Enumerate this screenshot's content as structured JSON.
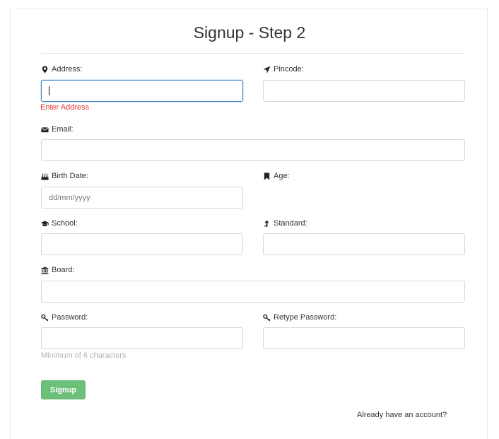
{
  "form": {
    "title": "Signup - Step 2",
    "address": {
      "label": "Address:",
      "value": "",
      "error": "Enter Address",
      "icon": "map-marker-icon"
    },
    "pincode": {
      "label": "Pincode:",
      "value": "",
      "icon": "location-arrow-icon"
    },
    "email": {
      "label": "Email:",
      "value": "",
      "icon": "envelope-icon"
    },
    "birth_date": {
      "label": "Birth Date:",
      "placeholder": "dd/mm/yyyy",
      "icon": "birthday-cake-icon"
    },
    "age": {
      "label": "Age:",
      "icon": "bookmark-icon"
    },
    "school": {
      "label": "School:",
      "value": "",
      "icon": "graduation-cap-icon"
    },
    "standard": {
      "label": "Standard:",
      "value": "",
      "icon": "level-up-icon"
    },
    "board": {
      "label": "Board:",
      "value": "",
      "icon": "institution-icon"
    },
    "password": {
      "label": "Password:",
      "value": "",
      "hint": "Minimum of 6 characters",
      "icon": "key-icon"
    },
    "retype_password": {
      "label": "Retype Password:",
      "value": "",
      "icon": "key-icon"
    },
    "submit_label": "Signup",
    "login_link": "Already have an account?"
  },
  "colors": {
    "focus_border": "#3e86c8",
    "error_text": "#e8372b",
    "button_bg": "#6cc07a",
    "hint_text": "#b3b3b3"
  }
}
